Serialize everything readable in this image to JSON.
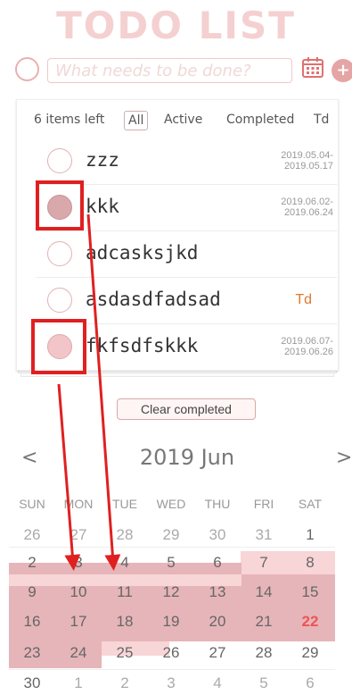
{
  "app": {
    "title": "TODO LIST"
  },
  "input": {
    "placeholder": "What needs to be done?"
  },
  "add_button": {
    "label": "+"
  },
  "filters": {
    "items_left": "6 items left",
    "all": "All",
    "active": "Active",
    "completed": "Completed",
    "td": "Td"
  },
  "todos": [
    {
      "text": "zzz",
      "start": "2019.05.04-",
      "end": "2019.05.17",
      "td": "",
      "checked": false
    },
    {
      "text": "kkk",
      "start": "2019.06.02-",
      "end": "2019.06.24",
      "td": "",
      "checked": true
    },
    {
      "text": "adcasksjkd",
      "start": "",
      "end": "",
      "td": "",
      "checked": false
    },
    {
      "text": "asdasdfadsad",
      "start": "",
      "end": "",
      "td": "Td",
      "checked": false
    },
    {
      "text": "fkfsdfskkk",
      "start": "2019.06.07-",
      "end": "2019.06.26",
      "td": "",
      "checked": true
    }
  ],
  "clear_completed": "Clear completed",
  "calendar": {
    "prev": "<",
    "next": ">",
    "title": "2019 Jun",
    "weekdays": [
      "SUN",
      "MON",
      "TUE",
      "WED",
      "THU",
      "FRI",
      "SAT"
    ],
    "weeks": [
      [
        "26",
        "27",
        "28",
        "29",
        "30",
        "31",
        "1"
      ],
      [
        "2",
        "3",
        "4",
        "5",
        "6",
        "7",
        "8"
      ],
      [
        "9",
        "10",
        "11",
        "12",
        "13",
        "14",
        "15"
      ],
      [
        "16",
        "17",
        "18",
        "19",
        "20",
        "21",
        "22"
      ],
      [
        "23",
        "24",
        "25",
        "26",
        "27",
        "28",
        "29"
      ],
      [
        "30",
        "1",
        "2",
        "3",
        "4",
        "5",
        "6"
      ]
    ],
    "today": "22"
  },
  "colors": {
    "accent": "#e5a5a5",
    "range_dark": "#e6b5b9",
    "range_light": "#f8d5d7",
    "annotation_red": "#e02020",
    "td_orange": "#e0782a"
  }
}
